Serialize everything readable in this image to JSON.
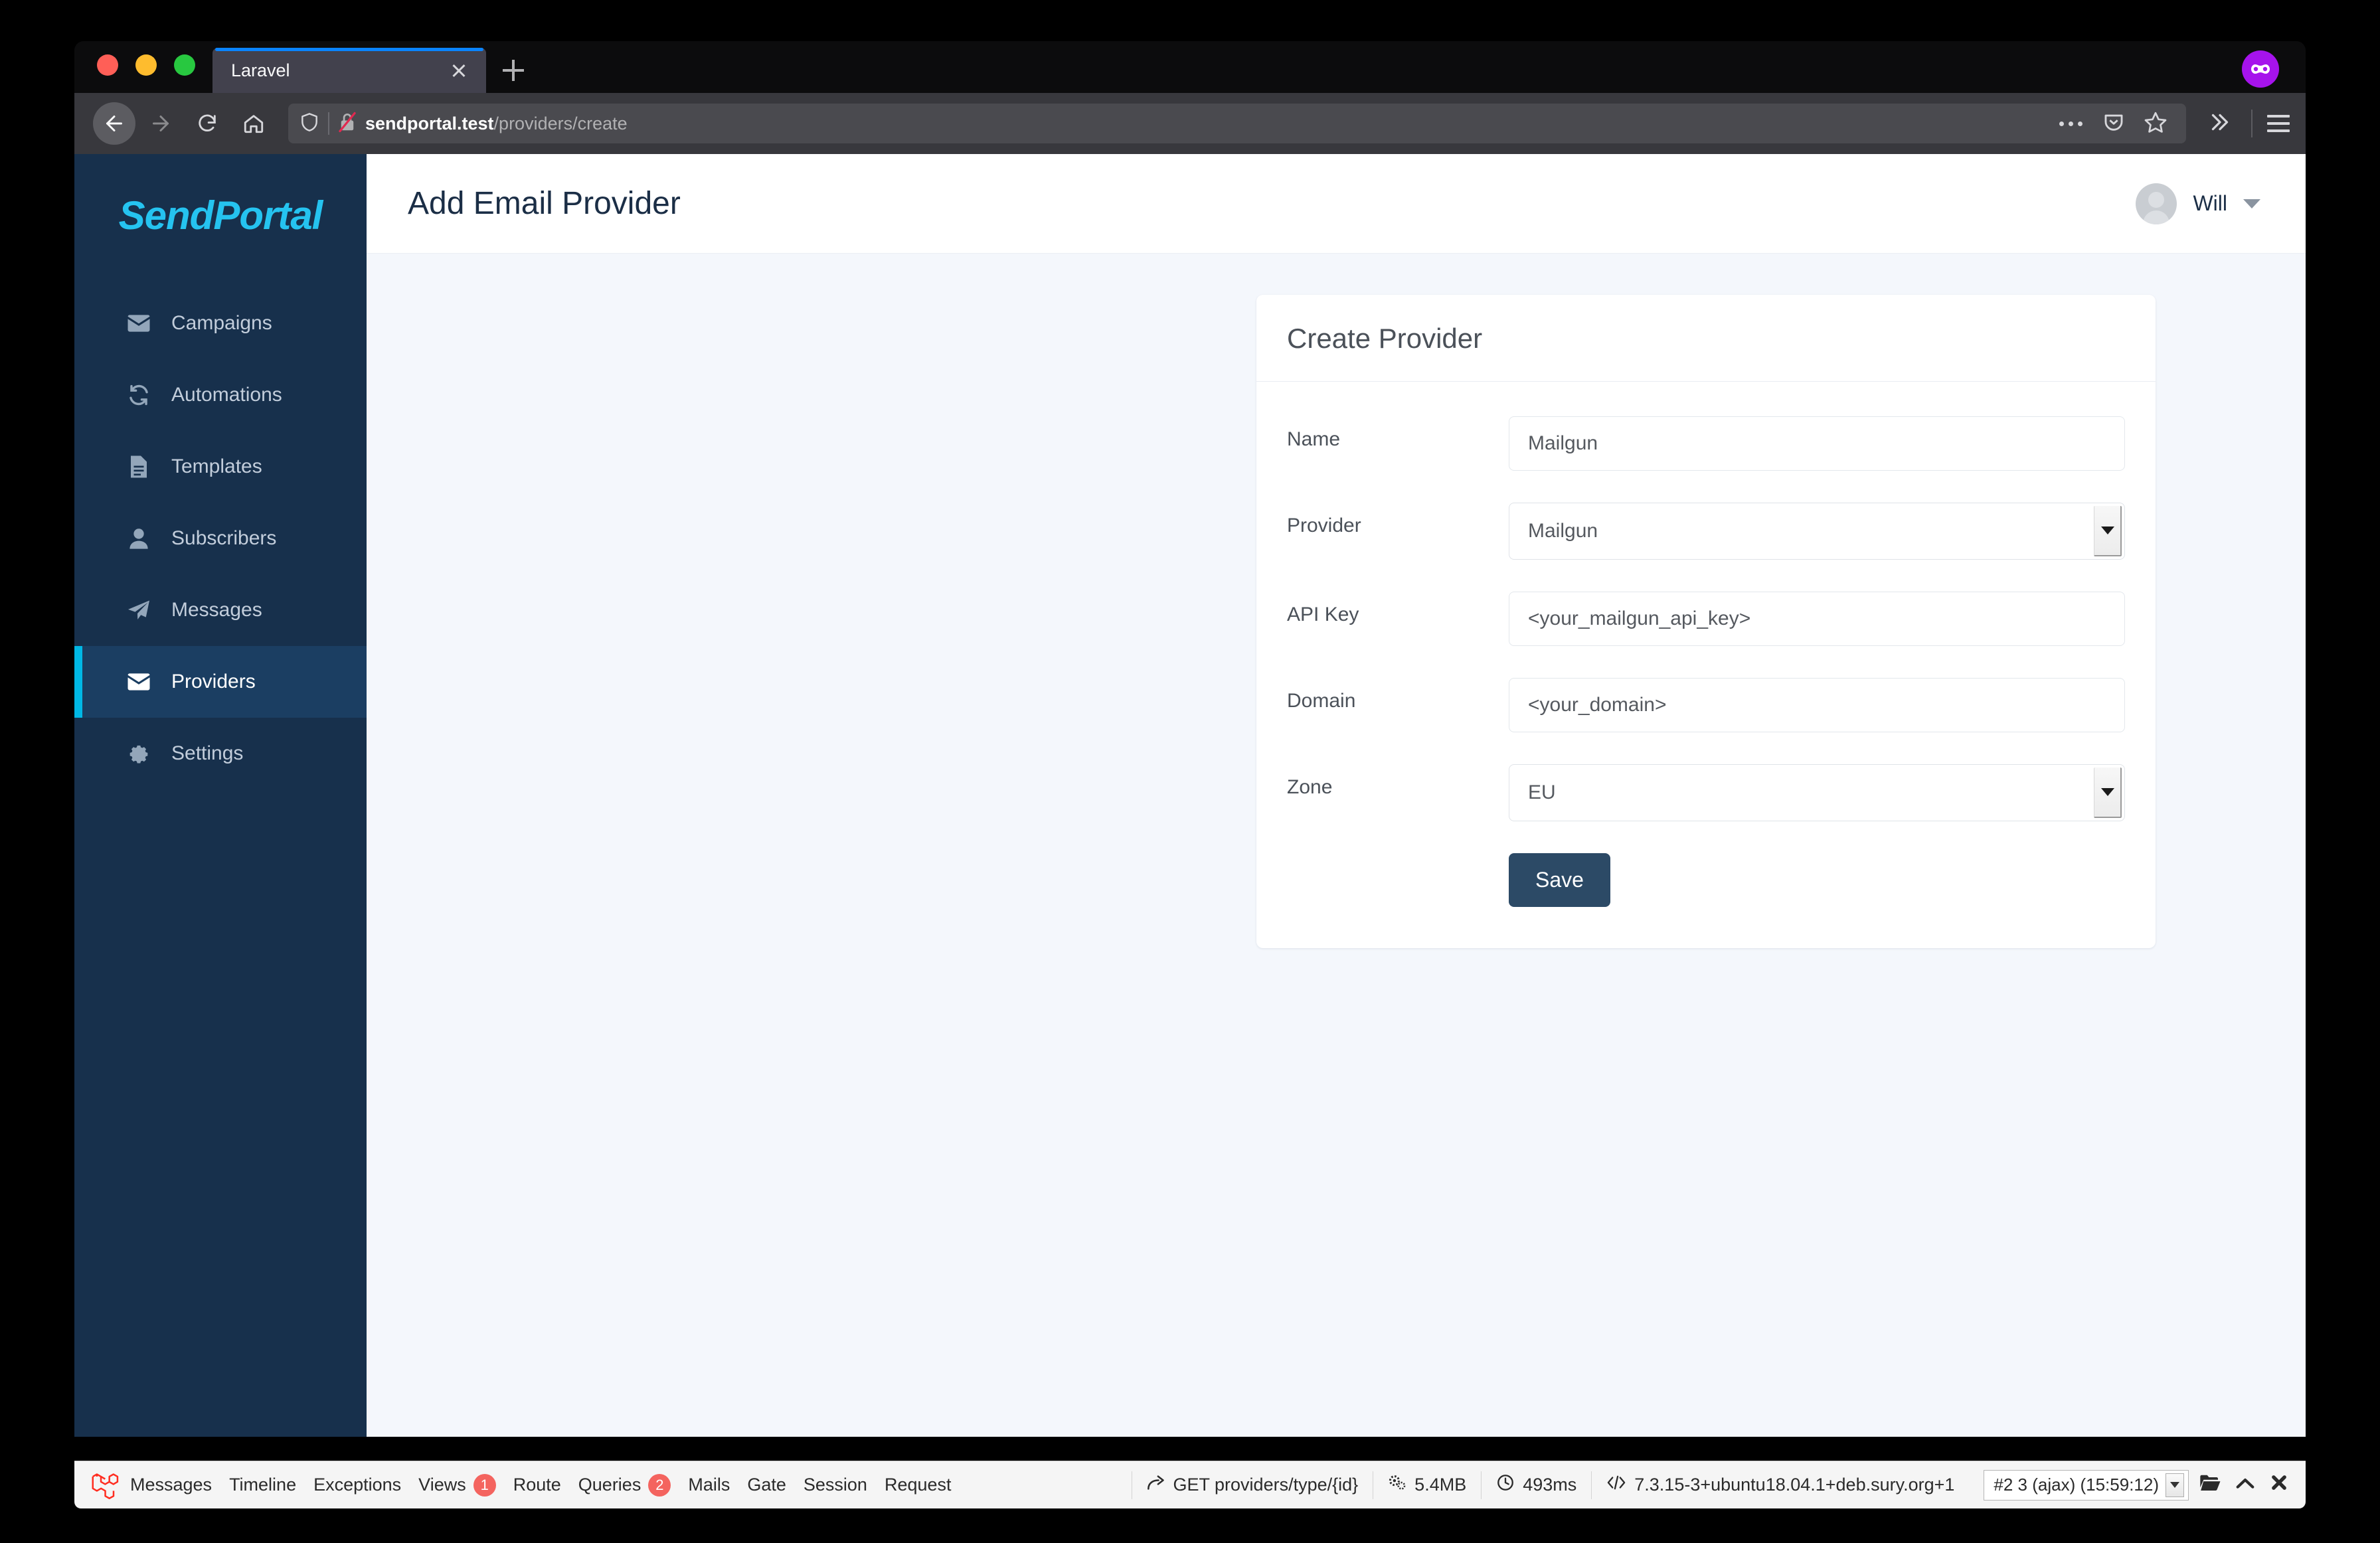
{
  "browser": {
    "tab_title": "Laravel",
    "url_host": "sendportal.test",
    "url_path": "/providers/create",
    "back_icon": "back-arrow-icon",
    "forward_icon": "forward-arrow-icon",
    "reload_icon": "reload-icon",
    "home_icon": "home-icon",
    "shield_icon": "shield-icon",
    "insecure_lock_icon": "insecure-lock-icon",
    "ellipsis_icon": "page-actions-icon",
    "pocket_icon": "pocket-icon",
    "bookmark_icon": "star-bookmark-icon",
    "overflow_icon": "chevrons-right-icon",
    "menu_icon": "hamburger-menu-icon",
    "private_badge_icon": "private-mask-icon",
    "new_tab_icon": "new-tab-icon",
    "close_tab_icon": "close-tab-icon"
  },
  "sidebar": {
    "brand": "SendPortal",
    "items": [
      {
        "label": "Campaigns",
        "icon": "envelope-icon",
        "active": false
      },
      {
        "label": "Automations",
        "icon": "refresh-icon",
        "active": false
      },
      {
        "label": "Templates",
        "icon": "document-icon",
        "active": false
      },
      {
        "label": "Subscribers",
        "icon": "user-icon",
        "active": false
      },
      {
        "label": "Messages",
        "icon": "paper-plane-icon",
        "active": false
      },
      {
        "label": "Providers",
        "icon": "envelope-icon",
        "active": true
      },
      {
        "label": "Settings",
        "icon": "gear-icon",
        "active": false
      }
    ]
  },
  "header": {
    "title": "Add Email Provider",
    "user_name": "Will",
    "avatar_icon": "avatar-icon",
    "caret_icon": "chevron-down-icon"
  },
  "card": {
    "title": "Create Provider",
    "fields": [
      {
        "label": "Name",
        "value": "Mailgun",
        "type": "text"
      },
      {
        "label": "Provider",
        "value": "Mailgun",
        "type": "select"
      },
      {
        "label": "API Key",
        "value": "<your_mailgun_api_key>",
        "type": "text"
      },
      {
        "label": "Domain",
        "value": "<your_domain>",
        "type": "text"
      },
      {
        "label": "Zone",
        "value": "EU",
        "type": "select"
      }
    ],
    "save_label": "Save"
  },
  "debugbar": {
    "logo_icon": "laravel-logo-icon",
    "tabs": [
      {
        "label": "Messages",
        "badge": null
      },
      {
        "label": "Timeline",
        "badge": null
      },
      {
        "label": "Exceptions",
        "badge": null
      },
      {
        "label": "Views",
        "badge": "1"
      },
      {
        "label": "Route",
        "badge": null
      },
      {
        "label": "Queries",
        "badge": "2"
      },
      {
        "label": "Mails",
        "badge": null
      },
      {
        "label": "Gate",
        "badge": null
      },
      {
        "label": "Session",
        "badge": null
      },
      {
        "label": "Request",
        "badge": null
      }
    ],
    "route": "GET providers/type/{id}",
    "route_icon": "share-arrow-icon",
    "memory": "5.4MB",
    "memory_icon": "cogs-icon",
    "time": "493ms",
    "time_icon": "clock-icon",
    "php_version": "7.3.15-3+ubuntu18.04.1+deb.sury.org+1",
    "php_icon": "code-icon",
    "request_select": "#2 3 (ajax) (15:59:12)",
    "open_icon": "folder-open-icon",
    "collapse_icon": "chevron-up-icon",
    "close_icon": "close-x-icon"
  },
  "colors": {
    "sidebar_bg": "#17304c",
    "sidebar_active_bg": "#1b3e62",
    "accent_cyan": "#00b8e6",
    "brand_cyan": "#25c3f0",
    "page_bg": "#f4f7fc",
    "save_button": "#2c4a66",
    "badge_red": "#f4645f",
    "tab_accent_blue": "#0a84ff"
  }
}
